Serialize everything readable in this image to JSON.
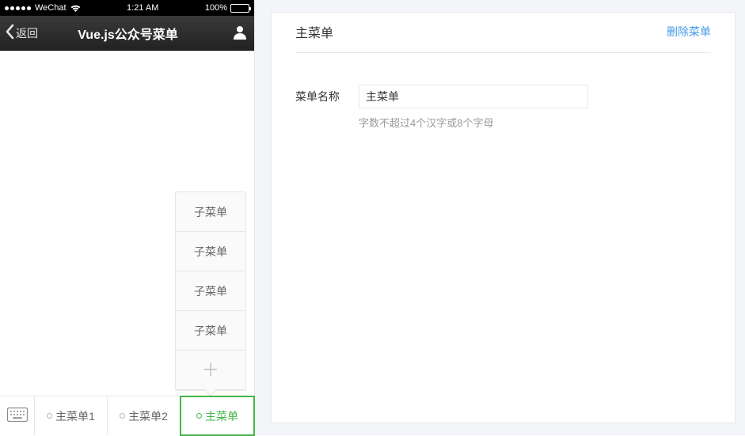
{
  "statusbar": {
    "carrier": "WeChat",
    "time": "1:21 AM",
    "battery": "100%"
  },
  "navbar": {
    "back": "返回",
    "title": "Vue.js公众号菜单"
  },
  "submenu": {
    "items": [
      "子菜单",
      "子菜单",
      "子菜单",
      "子菜单"
    ],
    "add_label": "＋"
  },
  "tabs": [
    {
      "label": "主菜单1",
      "active": false
    },
    {
      "label": "主菜单2",
      "active": false
    },
    {
      "label": "主菜单",
      "active": true
    }
  ],
  "editor": {
    "title": "主菜单",
    "delete_label": "删除菜单",
    "name_label": "菜单名称",
    "name_value": "主菜单",
    "name_hint": "字数不超过4个汉字或8个字母"
  },
  "icons": {
    "keyboard": "keyboard-icon",
    "profile": "profile-icon",
    "back": "chevron-left-icon",
    "wifi": "wifi-icon"
  }
}
